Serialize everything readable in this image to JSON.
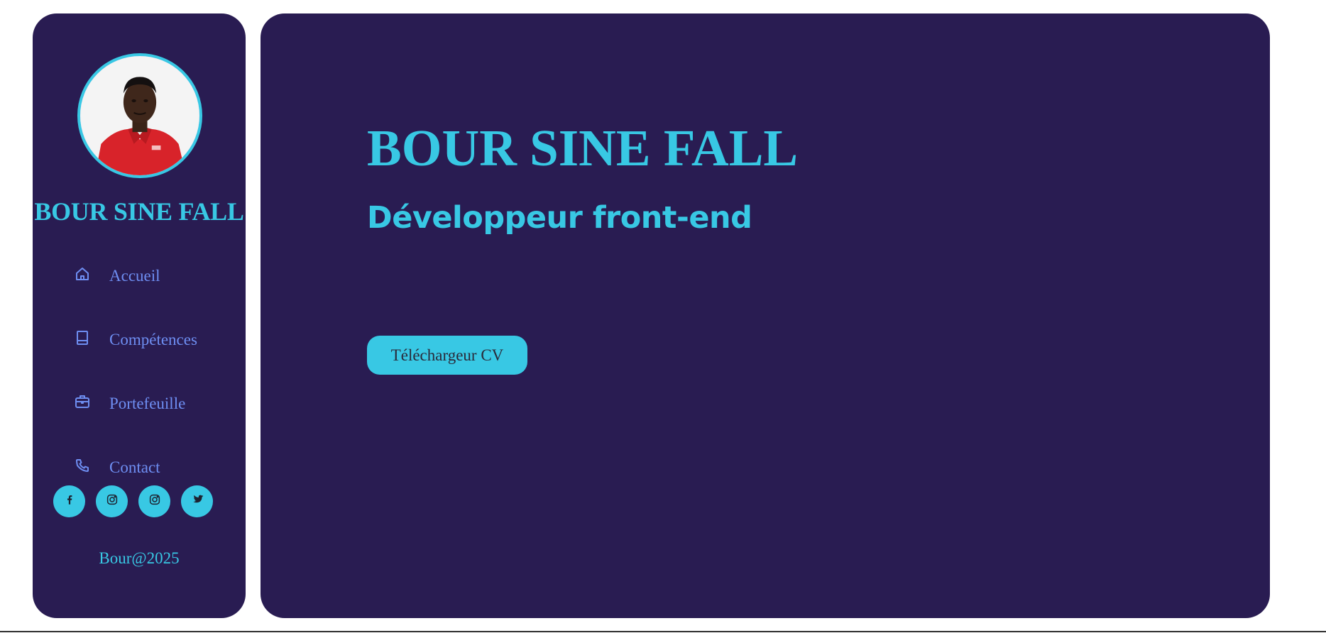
{
  "colors": {
    "panel_bg": "#291c52",
    "accent": "#38c8e4",
    "nav_text": "#6e8ef2",
    "page_bg": "#ffffff"
  },
  "sidebar": {
    "avatar_alt": "profile photo",
    "name": "BOUR SINE FALL",
    "nav": [
      {
        "label": "Accueil",
        "icon": "home-icon"
      },
      {
        "label": "Compétences",
        "icon": "book-icon"
      },
      {
        "label": "Portefeuille",
        "icon": "briefcase-icon"
      },
      {
        "label": "Contact",
        "icon": "phone-icon"
      }
    ],
    "socials": [
      {
        "icon": "facebook-icon"
      },
      {
        "icon": "instagram-icon"
      },
      {
        "icon": "instagram-icon"
      },
      {
        "icon": "twitter-icon"
      }
    ],
    "footer": "Bour@2025"
  },
  "main": {
    "title": "BOUR SINE FALL",
    "subtitle": "Développeur front-end",
    "cv_button": "Téléchargeur CV"
  }
}
